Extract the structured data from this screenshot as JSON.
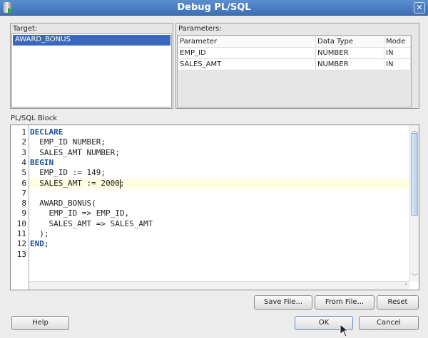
{
  "window": {
    "title": "Debug PL/SQL"
  },
  "target": {
    "label": "Target:",
    "items": [
      "AWARD_BONUS"
    ]
  },
  "parameters": {
    "label": "Parameters:",
    "columns": [
      "Parameter",
      "Data Type",
      "Mode"
    ],
    "rows": [
      [
        "EMP_ID",
        "NUMBER",
        "IN"
      ],
      [
        "SALES_AMT",
        "NUMBER",
        "IN"
      ]
    ]
  },
  "block": {
    "label": "PL/SQL Block",
    "lines": [
      "DECLARE",
      "  EMP_ID NUMBER;",
      "  SALES_AMT NUMBER;",
      "BEGIN",
      "  EMP_ID := 149;",
      "  SALES_AMT := 2000;",
      "",
      "  AWARD_BONUS(",
      "    EMP_ID => EMP_ID,",
      "    SALES_AMT => SALES_AMT",
      "  );",
      "END;",
      ""
    ],
    "current_line": 6
  },
  "buttons": {
    "save_file": "Save File...",
    "from_file": "From File...",
    "reset": "Reset",
    "help": "Help",
    "ok": "OK",
    "cancel": "Cancel"
  }
}
